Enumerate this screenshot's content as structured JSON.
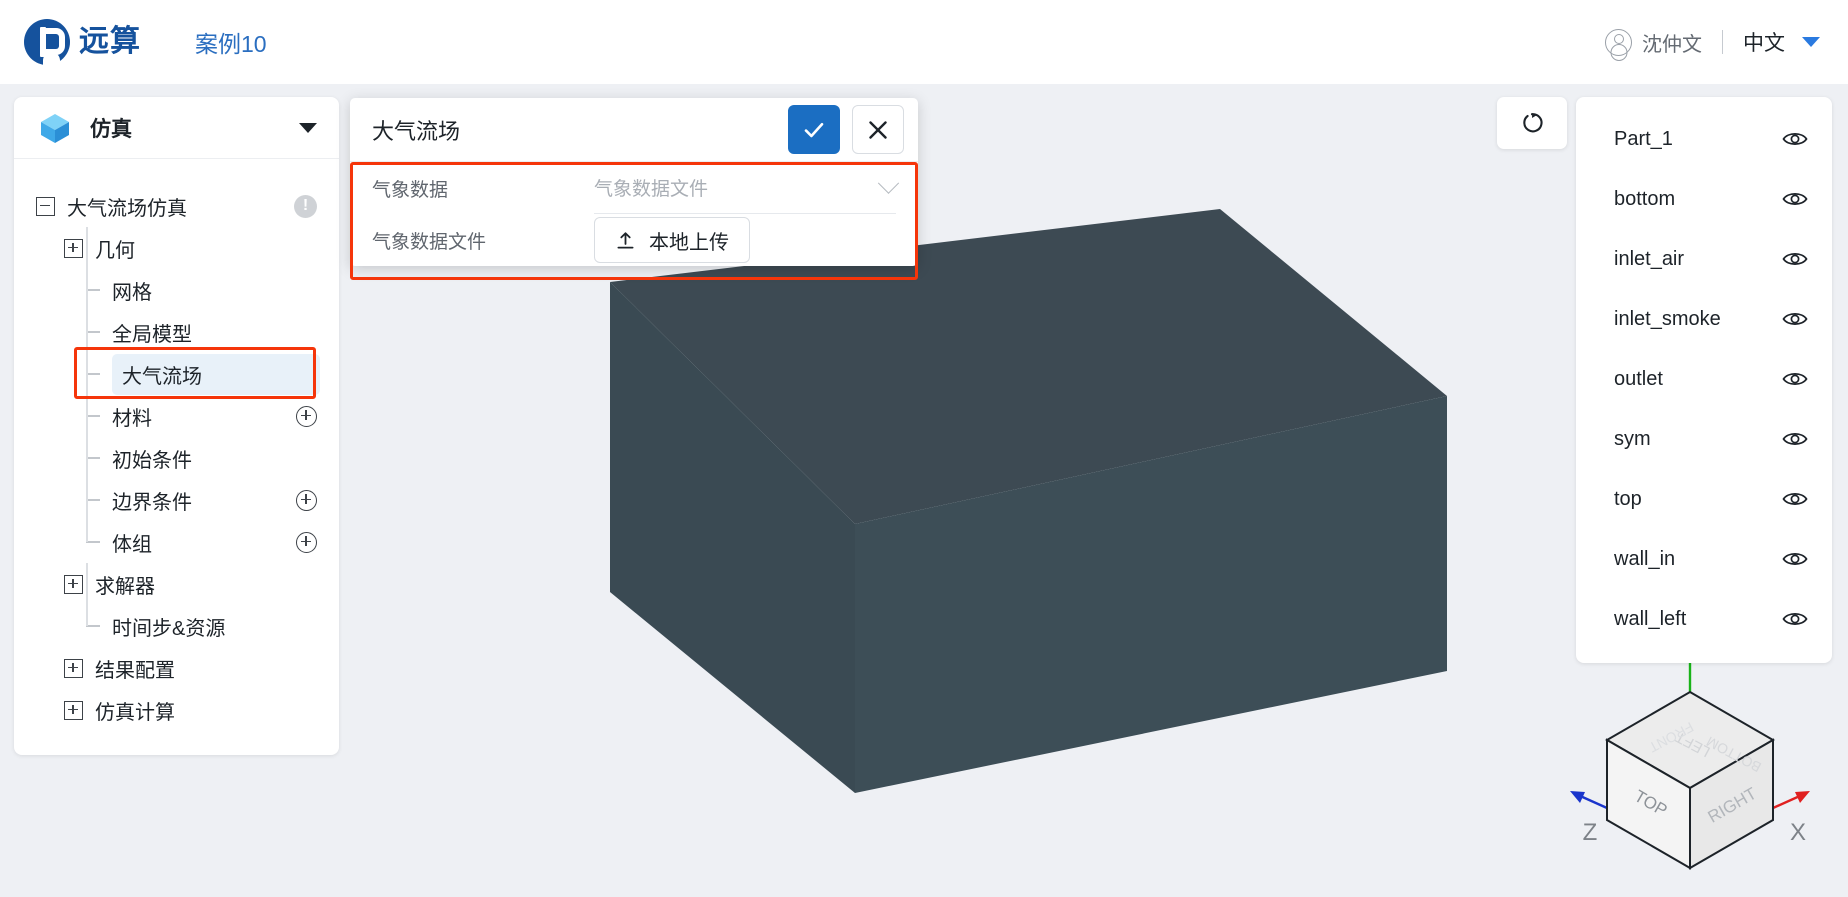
{
  "header": {
    "brand": "远算",
    "case_title": "案例10",
    "user_name": "沈仲文",
    "language": "中文",
    "logo_icon": "logo-mark-icon",
    "user_icon": "user-avatar-icon",
    "caret_icon": "chevron-down-icon",
    "brand_color": "#15529d",
    "case_color": "#2a6ec0"
  },
  "sidebar": {
    "panel_title": "仿真",
    "panel_icon": "cube-icon",
    "collapse_icon": "chevron-down-icon",
    "tree": [
      {
        "label": "大气流场仿真",
        "level": 0,
        "toggle": "minus",
        "badge": "!",
        "add": false,
        "selected": false
      },
      {
        "label": "几何",
        "level": 1,
        "toggle": "plus",
        "badge": null,
        "add": false,
        "selected": false
      },
      {
        "label": "网格",
        "level": 2,
        "toggle": "leaf",
        "badge": null,
        "add": false,
        "selected": false
      },
      {
        "label": "全局模型",
        "level": 2,
        "toggle": "leaf",
        "badge": null,
        "add": false,
        "selected": false
      },
      {
        "label": "大气流场",
        "level": 2,
        "toggle": "leaf",
        "badge": null,
        "add": false,
        "selected": true
      },
      {
        "label": "材料",
        "level": 2,
        "toggle": "leaf",
        "badge": null,
        "add": true,
        "selected": false
      },
      {
        "label": "初始条件",
        "level": 2,
        "toggle": "leaf",
        "badge": null,
        "add": false,
        "selected": false
      },
      {
        "label": "边界条件",
        "level": 2,
        "toggle": "leaf",
        "badge": null,
        "add": true,
        "selected": false
      },
      {
        "label": "体组",
        "level": 2,
        "toggle": "leaf",
        "badge": null,
        "add": true,
        "selected": false
      },
      {
        "label": "求解器",
        "level": 1,
        "toggle": "plus",
        "badge": null,
        "add": false,
        "selected": false
      },
      {
        "label": "时间步&资源",
        "level": 2,
        "toggle": "leaf",
        "badge": null,
        "add": false,
        "selected": false
      },
      {
        "label": "结果配置",
        "level": 1,
        "toggle": "plus",
        "badge": null,
        "add": false,
        "selected": false
      },
      {
        "label": "仿真计算",
        "level": 1,
        "toggle": "plus",
        "badge": null,
        "add": false,
        "selected": false
      }
    ],
    "highlight_color": "#f5350a"
  },
  "dialog": {
    "title": "大气流场",
    "confirm_icon": "check-icon",
    "cancel_icon": "close-icon",
    "confirm_color": "#1b6ec2",
    "highlight_color": "#f5350a",
    "fields": [
      {
        "label": "气象数据",
        "type": "select",
        "value": "",
        "placeholder": "气象数据文件",
        "icon": "chevron-down-icon"
      },
      {
        "label": "气象数据文件",
        "type": "upload",
        "button_label": "本地上传",
        "icon": "upload-icon"
      }
    ]
  },
  "viewport": {
    "reset_button_icon": "rotate-reset-icon",
    "geometry_color": "#3d4e57",
    "background_color": "#eef0f4"
  },
  "parts_panel": {
    "visibility_icon": "eye-icon",
    "items": [
      {
        "name": "Part_1",
        "visible": true
      },
      {
        "name": "bottom",
        "visible": true
      },
      {
        "name": "inlet_air",
        "visible": true
      },
      {
        "name": "inlet_smoke",
        "visible": true
      },
      {
        "name": "outlet",
        "visible": true
      },
      {
        "name": "sym",
        "visible": true
      },
      {
        "name": "top",
        "visible": true
      },
      {
        "name": "wall_in",
        "visible": true
      },
      {
        "name": "wall_left",
        "visible": true
      }
    ]
  },
  "view_cube": {
    "front_face": "TOP",
    "right_face": "RIGHT",
    "top_face_labels": [
      "LEFT",
      "FRONT",
      "BOTTOM"
    ],
    "axis_x": "X",
    "axis_z": "Z",
    "axis_x_color": "#e02020",
    "axis_y_color": "#19b319",
    "axis_z_color": "#1a35cc"
  }
}
